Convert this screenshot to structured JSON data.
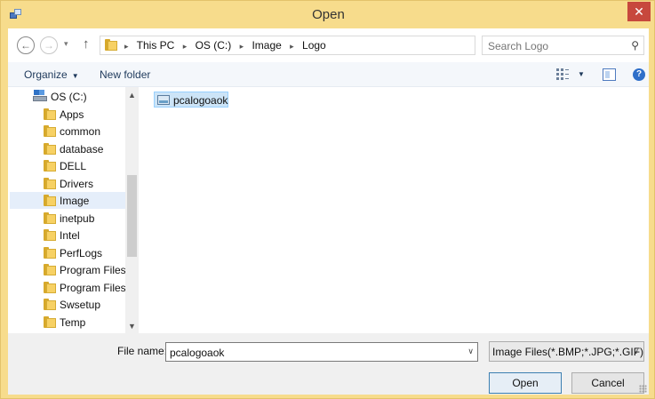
{
  "window": {
    "title": "Open",
    "close_glyph": "✕"
  },
  "address": {
    "back_glyph": "←",
    "forward_glyph": "→",
    "recent_glyph": "▾",
    "up_glyph": "↑",
    "breadcrumbs": [
      "This PC",
      "OS (C:)",
      "Image",
      "Logo"
    ],
    "separator_glyph": "▸",
    "dropdown_glyph": "∨",
    "refresh_glyph": "↻",
    "search_placeholder": "Search Logo",
    "search_glyph": "⚲"
  },
  "toolbar": {
    "organize_label": "Organize",
    "organize_caret": "▼",
    "new_folder_label": "New folder",
    "view_caret": "▼",
    "help_glyph": "?"
  },
  "nav_pane": {
    "drive_label": "OS (C:)",
    "folders": [
      "Apps",
      "common",
      "database",
      "DELL",
      "Drivers",
      "Image",
      "inetpub",
      "Intel",
      "PerfLogs",
      "Program Files",
      "Program Files (",
      "Swsetup",
      "Temp"
    ],
    "selected": "Image",
    "scroll_up_glyph": "▲",
    "scroll_down_glyph": "▼"
  },
  "content": {
    "files": [
      {
        "name": "pcalogoaok",
        "icon": "image-file-icon",
        "selected": true
      }
    ]
  },
  "footer": {
    "file_name_label": "File name:",
    "file_name_value": "pcalogoaok",
    "file_name_dropdown_glyph": "∨",
    "file_type_value": "Image Files(*.BMP;*.JPG;*.GIF)",
    "file_type_dropdown_glyph": "∨",
    "open_label": "Open",
    "cancel_label": "Cancel"
  },
  "colors": {
    "frame": "#f7dc8c",
    "close": "#c7483d",
    "accent_text": "#1e395b",
    "selection": "#cce4f7"
  }
}
